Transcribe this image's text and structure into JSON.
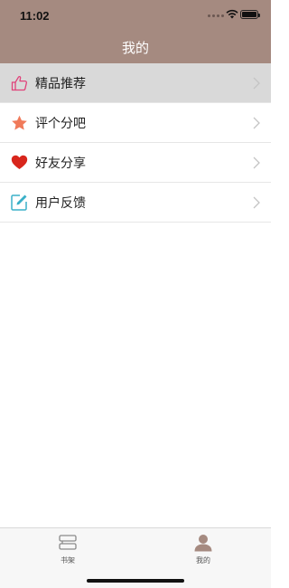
{
  "status_bar": {
    "time": "11:02"
  },
  "header": {
    "title": "我的"
  },
  "menu": {
    "items": [
      {
        "label": "精品推荐",
        "icon": "thumbs-up-icon",
        "icon_color": "#e0427a",
        "active": true
      },
      {
        "label": "评个分吧",
        "icon": "star-icon",
        "icon_color": "#f07a5a"
      },
      {
        "label": "好友分享",
        "icon": "heart-icon",
        "icon_color": "#d8261c"
      },
      {
        "label": "用户反馈",
        "icon": "edit-icon",
        "icon_color": "#3ab0c8"
      }
    ]
  },
  "tabbar": {
    "tabs": [
      {
        "label": "书架",
        "icon": "bookshelf-icon"
      },
      {
        "label": "我的",
        "icon": "user-icon",
        "selected": true
      }
    ]
  },
  "colors": {
    "header_bg": "#a58a80",
    "active_row_bg": "#d9d9d9",
    "tab_selected": "#a58a80"
  }
}
